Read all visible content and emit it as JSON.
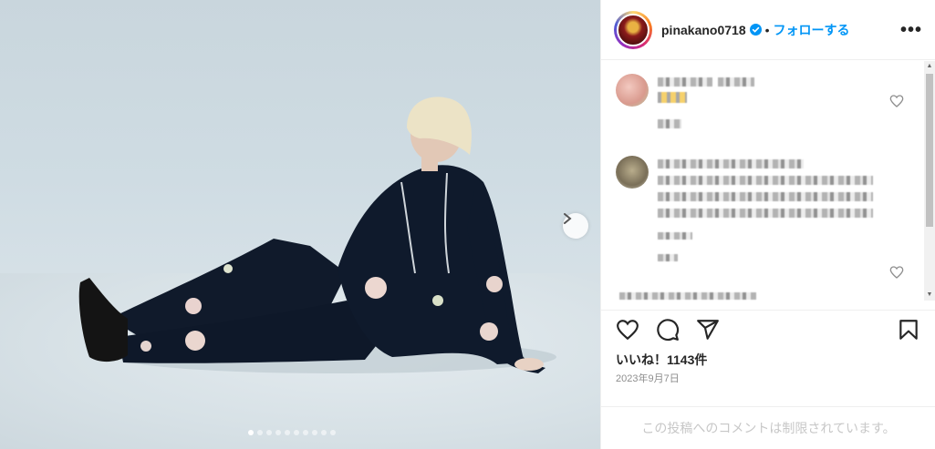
{
  "post": {
    "username": "pinakano0718",
    "separator": "•",
    "follow_label": "フォローする",
    "more_label": "•••",
    "likes_text": "いいね！1143件",
    "date_text": "2023年9月7日",
    "comments_restricted": "この投稿へのコメントは制限されています。"
  },
  "carousel": {
    "slide_count": 10,
    "active_index": 0
  },
  "colors": {
    "accent": "#0095f6",
    "text": "#262626",
    "muted": "#8e8e8e"
  },
  "icons": {
    "verified": "verified-badge-icon",
    "like": "heart-icon",
    "comment": "comment-icon",
    "share": "paper-plane-icon",
    "save": "bookmark-icon",
    "next": "chevron-right-icon"
  }
}
